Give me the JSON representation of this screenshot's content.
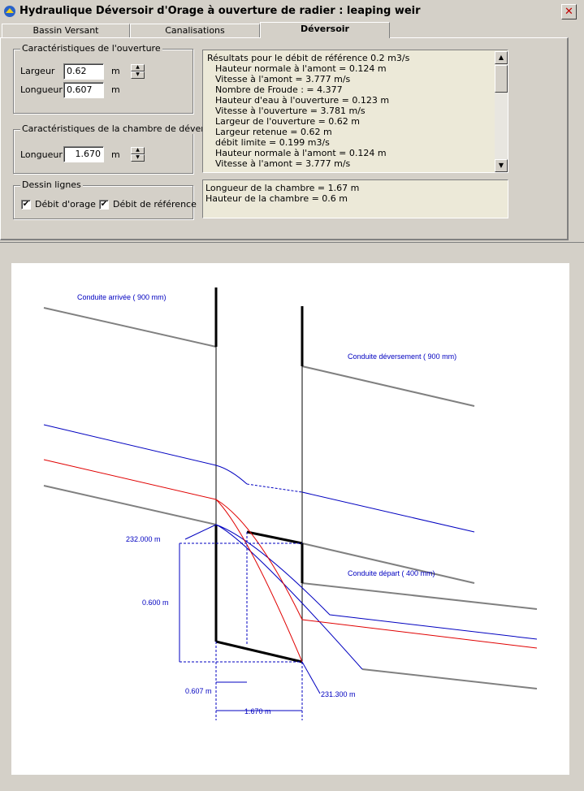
{
  "window": {
    "title": "Hydraulique Déversoir d'Orage à ouverture de radier : leaping weir",
    "close": "✕"
  },
  "tabs": [
    {
      "label": "Bassin Versant"
    },
    {
      "label": "Canalisations"
    },
    {
      "label": "Déversoir",
      "active": true
    }
  ],
  "opening": {
    "legend": "Caractéristiques de l'ouverture",
    "width_label": "Largeur",
    "width_value": "0.62",
    "width_unit": "m",
    "length_label": "Longueur",
    "length_value": "0.607",
    "length_unit": "m"
  },
  "chamber": {
    "legend": "Caractéristiques de la chambre de déversoir",
    "length_label": "Longueur",
    "length_value": "1.670",
    "length_unit": "m"
  },
  "lines": {
    "legend": "Dessin lignes",
    "storm_label": "Débit d'orage",
    "storm_checked": true,
    "reference_label": "Débit de référence",
    "reference_checked": true
  },
  "results": [
    "Résultats pour le débit de référence 0.2 m3/s",
    "Hauteur normale à l'amont = 0.124 m",
    "Vitesse à l'amont = 3.777 m/s",
    "Nombre de Froude : = 4.377",
    "Hauteur d'eau à l'ouverture = 0.123 m",
    "Vitesse à l'ouverture = 3.781 m/s",
    "Largeur de l'ouverture = 0.62 m",
    "Largeur retenue = 0.62 m",
    "débit limite = 0.199 m3/s",
    "Hauteur normale à l'amont = 0.124 m",
    "Vitesse à l'amont = 3.777 m/s"
  ],
  "summary": [
    "Longueur de la chambre = 1.67 m",
    "Hauteur de la chambre = 0.6 m"
  ],
  "drawing": {
    "inlet_label": "Conduite arrivée ( 900 mm)",
    "overflow_label": "Conduite déversement ( 900 mm)",
    "outlet_label": "Conduite départ ( 400 mm)",
    "elev_top": "232.000 m",
    "elev_bottom": "231.300 m",
    "chamber_height": "0.600 m",
    "opening_length": "0.607 m",
    "chamber_length": "1.670 m",
    "colors": {
      "pipe": "#808080",
      "wall": "#000000",
      "storm": "#0000c0",
      "reference": "#e00000",
      "dim": "#0000c0"
    }
  }
}
